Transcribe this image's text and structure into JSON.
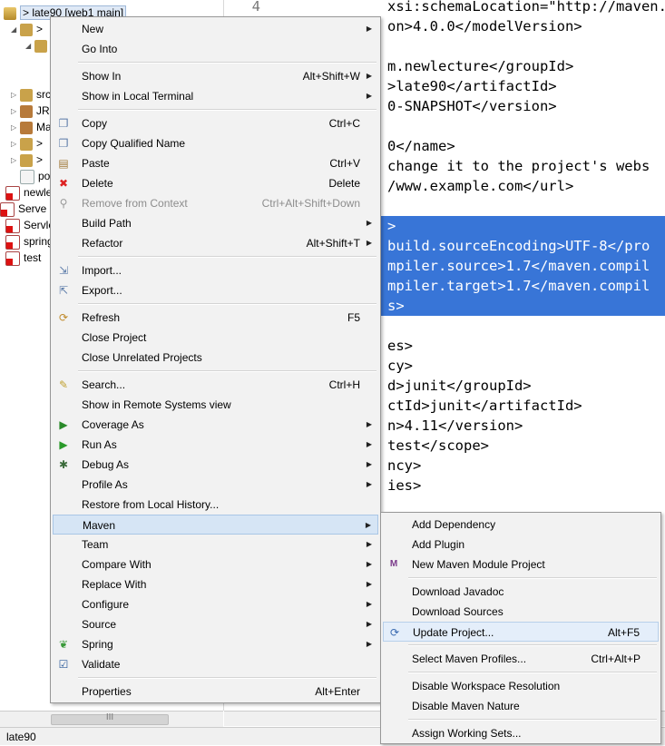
{
  "explorer": {
    "items": [
      {
        "label": "> late90 [web1 main]",
        "icon": "maven-project-icon"
      },
      {
        "label": ">",
        "icon": "folder-icon"
      },
      {
        "label": "",
        "icon": "package-icon"
      },
      {
        "label": "src",
        "icon": "source-folder-icon"
      },
      {
        "label": "JR",
        "icon": "library-icon"
      },
      {
        "label": "Ma",
        "icon": "maven-deps-icon"
      },
      {
        "label": ">",
        "icon": "folder-icon"
      },
      {
        "label": ">",
        "icon": "folder-icon"
      },
      {
        "label": "po",
        "icon": "pom-file-icon"
      },
      {
        "label": "newle",
        "icon": "project-error-icon"
      },
      {
        "label": "Serve",
        "icon": "project-error-icon"
      },
      {
        "label": "Servle",
        "icon": "project-error-icon"
      },
      {
        "label": "spring",
        "icon": "project-error-icon"
      },
      {
        "label": "test",
        "icon": "project-error-icon"
      }
    ],
    "scroll_grip": "III"
  },
  "status": {
    "selection": "late90"
  },
  "editor": {
    "first_line_number": "4",
    "lines": [
      {
        "text": "xsi:schemaLocation=\"http://maven.apache.or",
        "selected": false
      },
      {
        "text": "on>4.0.0</modelVersion>",
        "selected": false
      },
      {
        "text": "",
        "selected": false
      },
      {
        "text": "m.newlecture</groupId>",
        "selected": false
      },
      {
        "text": ">late90</artifactId>",
        "selected": false
      },
      {
        "text": "0-SNAPSHOT</version>",
        "selected": false
      },
      {
        "text": "",
        "selected": false
      },
      {
        "text": "0</name>",
        "selected": false
      },
      {
        "text": "change it to the project's webs",
        "selected": false
      },
      {
        "text": "/www.example.com</url>",
        "selected": false
      },
      {
        "text": "",
        "selected": false
      },
      {
        "text": ">",
        "selected": true
      },
      {
        "text": "build.sourceEncoding>UTF-8</pro",
        "selected": true
      },
      {
        "text": "mpiler.source>1.7</maven.compil",
        "selected": true
      },
      {
        "text": "mpiler.target>1.7</maven.compil",
        "selected": true
      },
      {
        "text": "s>",
        "selected": true
      },
      {
        "text": "",
        "selected": false
      },
      {
        "text": "es>",
        "selected": false
      },
      {
        "text": "cy>",
        "selected": false
      },
      {
        "text": "d>junit</groupId>",
        "selected": false
      },
      {
        "text": "ctId>junit</artifactId>",
        "selected": false
      },
      {
        "text": "n>4.11</version>",
        "selected": false
      },
      {
        "text": "test</scope>",
        "selected": false
      },
      {
        "text": "ncy>",
        "selected": false
      },
      {
        "text": "ies>",
        "selected": false
      }
    ]
  },
  "context_menu": {
    "items": [
      {
        "type": "item",
        "label": "New",
        "submenu": true
      },
      {
        "type": "item",
        "label": "Go Into"
      },
      {
        "type": "sep"
      },
      {
        "type": "item",
        "label": "Show In",
        "accel": "Alt+Shift+W",
        "submenu": true
      },
      {
        "type": "item",
        "label": "Show in Local Terminal",
        "submenu": true
      },
      {
        "type": "sep"
      },
      {
        "type": "item",
        "label": "Copy",
        "accel": "Ctrl+C",
        "icon": "copy-icon"
      },
      {
        "type": "item",
        "label": "Copy Qualified Name",
        "icon": "copy-qualified-icon"
      },
      {
        "type": "item",
        "label": "Paste",
        "accel": "Ctrl+V",
        "icon": "paste-icon"
      },
      {
        "type": "item",
        "label": "Delete",
        "accel": "Delete",
        "icon": "delete-icon"
      },
      {
        "type": "item",
        "label": "Remove from Context",
        "accel": "Ctrl+Alt+Shift+Down",
        "icon": "remove-context-icon",
        "disabled": true
      },
      {
        "type": "item",
        "label": "Build Path",
        "submenu": true
      },
      {
        "type": "item",
        "label": "Refactor",
        "accel": "Alt+Shift+T",
        "submenu": true
      },
      {
        "type": "sep"
      },
      {
        "type": "item",
        "label": "Import...",
        "icon": "import-icon"
      },
      {
        "type": "item",
        "label": "Export...",
        "icon": "export-icon"
      },
      {
        "type": "sep"
      },
      {
        "type": "item",
        "label": "Refresh",
        "accel": "F5",
        "icon": "refresh-icon"
      },
      {
        "type": "item",
        "label": "Close Project"
      },
      {
        "type": "item",
        "label": "Close Unrelated Projects"
      },
      {
        "type": "sep"
      },
      {
        "type": "item",
        "label": "Search...",
        "accel": "Ctrl+H",
        "icon": "search-icon"
      },
      {
        "type": "item",
        "label": "Show in Remote Systems view"
      },
      {
        "type": "item",
        "label": "Coverage As",
        "submenu": true,
        "icon": "coverage-icon"
      },
      {
        "type": "item",
        "label": "Run As",
        "submenu": true,
        "icon": "run-icon"
      },
      {
        "type": "item",
        "label": "Debug As",
        "submenu": true,
        "icon": "debug-icon"
      },
      {
        "type": "item",
        "label": "Profile As",
        "submenu": true
      },
      {
        "type": "item",
        "label": "Restore from Local History..."
      },
      {
        "type": "item",
        "label": "Maven",
        "submenu": true,
        "highlight": true
      },
      {
        "type": "item",
        "label": "Team",
        "submenu": true
      },
      {
        "type": "item",
        "label": "Compare With",
        "submenu": true
      },
      {
        "type": "item",
        "label": "Replace With",
        "submenu": true
      },
      {
        "type": "item",
        "label": "Configure",
        "submenu": true
      },
      {
        "type": "item",
        "label": "Source",
        "submenu": true
      },
      {
        "type": "item",
        "label": "Spring",
        "submenu": true,
        "icon": "spring-icon"
      },
      {
        "type": "item",
        "label": "Validate",
        "icon": "checkbox-icon"
      },
      {
        "type": "sep"
      },
      {
        "type": "item",
        "label": "Properties",
        "accel": "Alt+Enter"
      }
    ]
  },
  "maven_menu": {
    "items": [
      {
        "type": "item",
        "label": "Add Dependency"
      },
      {
        "type": "item",
        "label": "Add Plugin"
      },
      {
        "type": "item",
        "label": "New Maven Module Project",
        "icon": "maven-module-icon"
      },
      {
        "type": "sep"
      },
      {
        "type": "item",
        "label": "Download Javadoc"
      },
      {
        "type": "item",
        "label": "Download Sources"
      },
      {
        "type": "item",
        "label": "Update Project...",
        "accel": "Alt+F5",
        "icon": "update-project-icon",
        "hover": true
      },
      {
        "type": "sep"
      },
      {
        "type": "item",
        "label": "Select Maven Profiles...",
        "accel": "Ctrl+Alt+P"
      },
      {
        "type": "sep"
      },
      {
        "type": "item",
        "label": "Disable Workspace Resolution"
      },
      {
        "type": "item",
        "label": "Disable Maven Nature"
      },
      {
        "type": "sep"
      },
      {
        "type": "item",
        "label": "Assign Working Sets..."
      }
    ]
  },
  "colors": {
    "selection": "#3875d7",
    "menu_highlight": "#d6e5f5",
    "tag": "#008080",
    "string": "#2a00ff"
  }
}
